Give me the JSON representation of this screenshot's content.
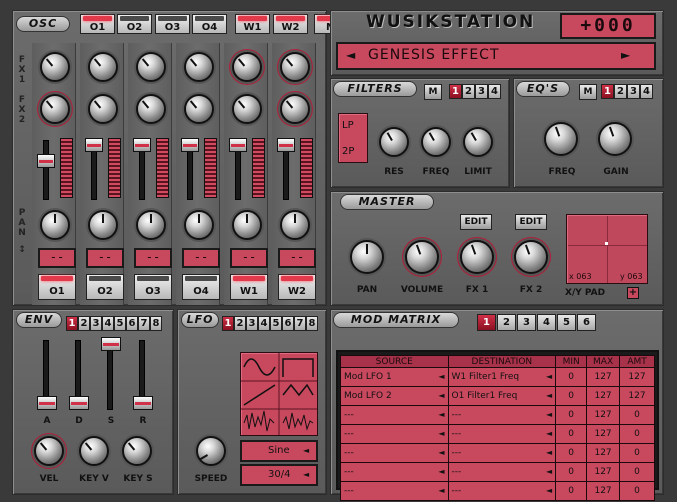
{
  "app": {
    "title": "WUSIKSTATION",
    "counter": "+000",
    "preset": "GENESIS EFFECT"
  },
  "osc": {
    "label": "OSC",
    "top_buttons": [
      "O1",
      "O2",
      "O3",
      "O4",
      "W1",
      "W2"
    ],
    "m_button": "M",
    "fx_labels": [
      "FX1",
      "FX2"
    ],
    "pan_label": "PAN",
    "pan_arrows": "↕",
    "channel_displays": [
      "--",
      "--",
      "--",
      "--",
      "--",
      "--"
    ],
    "bottom_buttons": [
      "O1",
      "O2",
      "O3",
      "O4",
      "W1",
      "W2"
    ]
  },
  "filters": {
    "label": "FILTERS",
    "m": "M",
    "tabs": [
      "1",
      "2",
      "3",
      "4"
    ],
    "types": [
      "LP",
      "2P"
    ],
    "knobs": [
      "RES",
      "FREQ",
      "LIMIT"
    ]
  },
  "eqs": {
    "label": "EQ'S",
    "m": "M",
    "tabs": [
      "1",
      "2",
      "3",
      "4"
    ],
    "knobs": [
      "FREQ",
      "GAIN"
    ]
  },
  "master": {
    "label": "MASTER",
    "knobs": [
      "PAN",
      "VOLUME",
      "FX 1",
      "FX 2"
    ],
    "edit1": "EDIT",
    "edit2": "EDIT",
    "xy_label": "X/Y PAD",
    "xy_x": "x 063",
    "xy_y": "y 063",
    "xy_plus": "+"
  },
  "env": {
    "label": "ENV",
    "tabs": [
      "1",
      "2",
      "3",
      "4",
      "5",
      "6",
      "7",
      "8"
    ],
    "sliders": [
      "A",
      "D",
      "S",
      "R"
    ],
    "knobs": [
      "VEL",
      "KEY V",
      "KEY S"
    ]
  },
  "lfo": {
    "label": "LFO",
    "tabs": [
      "1",
      "2",
      "3",
      "4",
      "5",
      "6",
      "7",
      "8"
    ],
    "speed": "SPEED",
    "wave": "Sine",
    "rate": "30/4"
  },
  "mod": {
    "label": "MOD MATRIX",
    "tabs": [
      "1",
      "2",
      "3",
      "4",
      "5",
      "6"
    ],
    "headers": [
      "SOURCE",
      "DESTINATION",
      "MIN",
      "MAX",
      "AMT"
    ],
    "rows": [
      {
        "source": "Mod LFO 1",
        "dest": "W1 Filter1 Freq",
        "min": "0",
        "max": "127",
        "amt": "127"
      },
      {
        "source": "Mod LFO 2",
        "dest": "O1 Filter1 Freq",
        "min": "0",
        "max": "127",
        "amt": "127"
      },
      {
        "source": "---",
        "dest": "---",
        "min": "0",
        "max": "127",
        "amt": "0"
      },
      {
        "source": "---",
        "dest": "---",
        "min": "0",
        "max": "127",
        "amt": "0"
      },
      {
        "source": "---",
        "dest": "---",
        "min": "0",
        "max": "127",
        "amt": "0"
      },
      {
        "source": "---",
        "dest": "---",
        "min": "0",
        "max": "127",
        "amt": "0"
      },
      {
        "source": "---",
        "dest": "---",
        "min": "0",
        "max": "127",
        "amt": "0"
      }
    ]
  },
  "colors": {
    "accent": "#c8485e",
    "panel": "#666666",
    "led": "#e23a4a"
  },
  "arrows": {
    "left": "◄",
    "right": "►"
  }
}
